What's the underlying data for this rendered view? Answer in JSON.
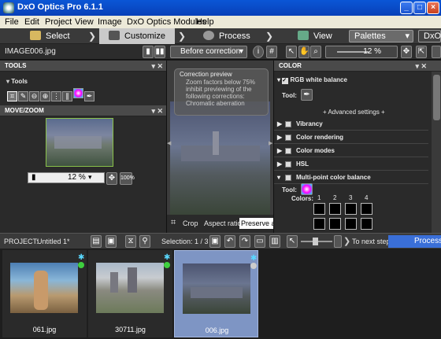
{
  "window": {
    "title": "DxO Optics Pro 6.1.1"
  },
  "menu": {
    "items": [
      "File",
      "Edit",
      "Project",
      "View",
      "Image",
      "DxO Optics Modules",
      "Help"
    ]
  },
  "workflow": {
    "select": "Select",
    "customize": "Customize",
    "process": "Process",
    "view": "View",
    "palettes": "Palettes",
    "preset": "DxO -"
  },
  "toolbar": {
    "image_label": "IMAGE:",
    "image_name": "006.jpg",
    "compare": "Before correction",
    "zoom": "12 %"
  },
  "tools_panel": {
    "title": "TOOLS",
    "subtitle": "Tools"
  },
  "movezoom": {
    "title": "MOVE/ZOOM",
    "zoom": "12 %",
    "zoom_btn": "100%"
  },
  "viewer": {
    "tooltip_title": "Correction preview",
    "tooltip_body": "Zoom factors below 75% inhibit previewing of the following corrections: Chromatic aberration",
    "crop_label": "Crop",
    "aspect_label": "Aspect ratio:",
    "aspect_value": "Preserve as"
  },
  "color_panel": {
    "title": "COLOR",
    "wb": "RGB white balance",
    "tool_label": "Tool:",
    "advanced": "+ Advanced settings +",
    "sections": [
      "Vibrancy",
      "Color rendering",
      "Color modes",
      "HSL",
      "Multi-point color balance"
    ],
    "mp_tool": "Tool:",
    "colors_label": "Colors:",
    "color_nums": [
      "1",
      "2",
      "3",
      "4"
    ]
  },
  "project": {
    "label": "PROJECT:",
    "name": "Untitled 1*",
    "selection": "Selection: 1 / 3",
    "next_step": "To next step",
    "process_btn": "Process"
  },
  "thumbnails": [
    {
      "name": "061.jpg",
      "status": "#3ecf3e"
    },
    {
      "name": "30711.jpg",
      "status": "#3ecf3e"
    },
    {
      "name": "006.jpg",
      "status": "#cccccc"
    }
  ]
}
